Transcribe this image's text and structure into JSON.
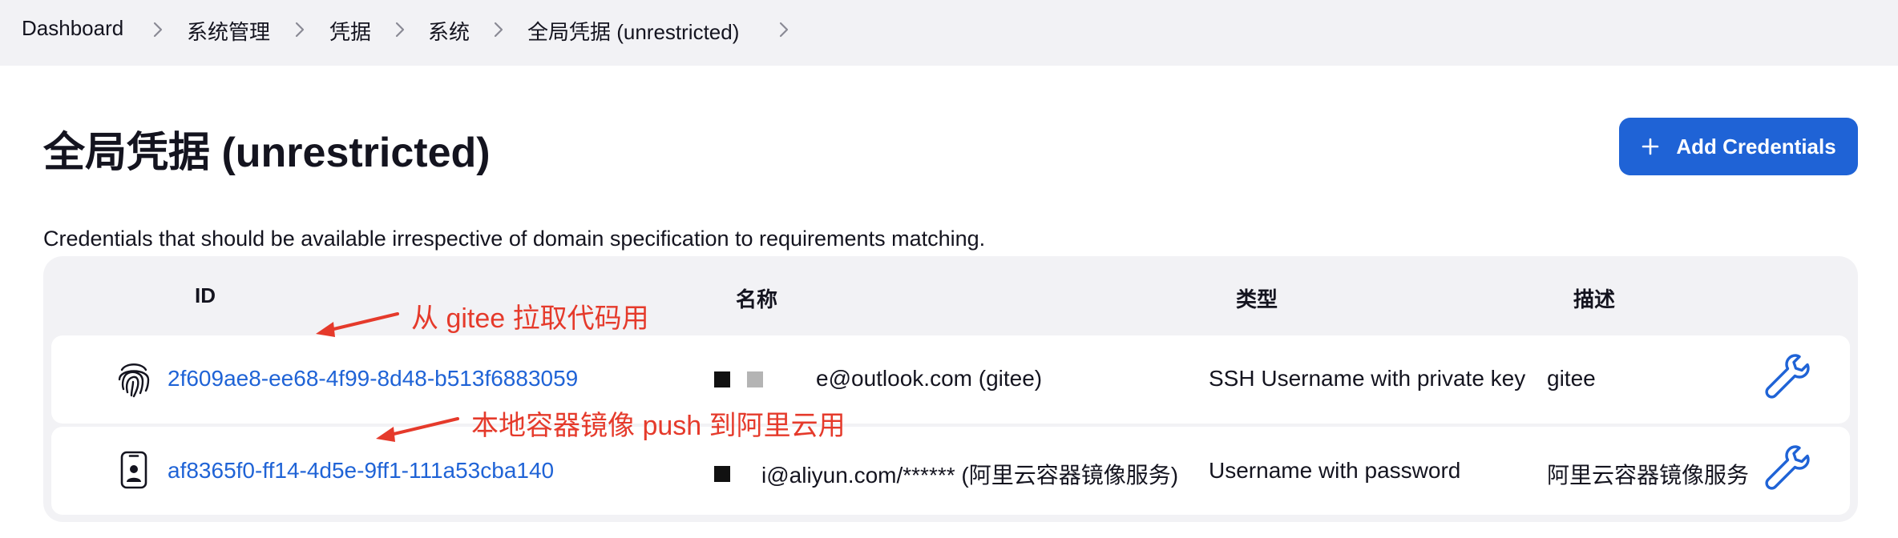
{
  "breadcrumb": {
    "items": [
      {
        "label": "Dashboard"
      },
      {
        "label": "系统管理"
      },
      {
        "label": "凭据"
      },
      {
        "label": "系统"
      },
      {
        "label": "全局凭据 (unrestricted)"
      }
    ]
  },
  "page": {
    "title": "全局凭据 (unrestricted)",
    "add_button_label": "Add Credentials",
    "description": "Credentials that should be available irrespective of domain specification to requirements matching."
  },
  "table": {
    "headers": {
      "id": "ID",
      "name": "名称",
      "type": "类型",
      "description": "描述"
    },
    "rows": [
      {
        "icon": "fingerprint-icon",
        "id": "2f609ae8-ee68-4f99-8d48-b513f6883059",
        "name": "e@outlook.com (gitee)",
        "type": "SSH Username with private key",
        "description": "gitee",
        "action_icon": "wrench-icon"
      },
      {
        "icon": "id-badge-icon",
        "id": "af8365f0-ff14-4d5e-9ff1-111a53cba140",
        "name": "i@aliyun.com/****** (阿里云容器镜像服务)",
        "type": "Username with password",
        "description": "阿里云容器镜像服务",
        "action_icon": "wrench-icon"
      }
    ]
  },
  "annotations": [
    {
      "text": "从 gitee 拉取代码用"
    },
    {
      "text": "本地容器镜像 push 到阿里云用"
    }
  ],
  "colors": {
    "accent": "#1f63d6",
    "annotation": "#e53a2b",
    "panel_bg": "#f2f2f5",
    "text": "#14141f"
  }
}
